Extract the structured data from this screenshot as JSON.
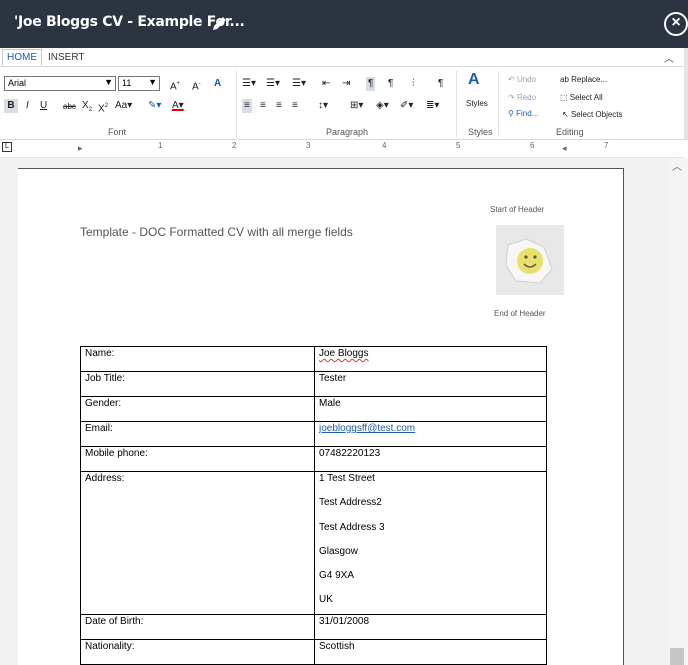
{
  "window": {
    "title": "'Joe Bloggs CV - Example For..."
  },
  "ribbon": {
    "tabs": [
      "HOME",
      "INSERT"
    ],
    "font": {
      "family": "Arial",
      "size": "11",
      "group_label": "Font"
    },
    "paragraph": {
      "group_label": "Paragraph"
    },
    "styles": {
      "label": "Styles",
      "group_label": "Styles"
    },
    "editing": {
      "undo": "Undo",
      "redo": "Redo",
      "find": "Find...",
      "replace": "Replace...",
      "select_all": "Select All",
      "select_objects": "Select Objects",
      "group_label": "Editing"
    }
  },
  "ruler": {
    "marks": [
      "1",
      "2",
      "3",
      "4",
      "5",
      "6",
      "7"
    ]
  },
  "document": {
    "header_start": "Start of Header",
    "header_end": "End of Header",
    "template_text": "Template - DOC Formatted CV with all merge fields",
    "table": {
      "rows": [
        {
          "label": "Name:",
          "value": "Joe Bloggs"
        },
        {
          "label": "Job Title:",
          "value": "Tester"
        },
        {
          "label": "Gender:",
          "value": "Male"
        },
        {
          "label": "Email:",
          "value": "joebloggsff@test.com"
        },
        {
          "label": "Mobile phone:",
          "value": "07482220123"
        },
        {
          "label": "Address:",
          "lines": [
            "1 Test Street",
            "Test Address2",
            "Test Address 3",
            "Glasgow",
            "G4 9XA",
            "UK"
          ]
        },
        {
          "label": "Date of Birth:",
          "value": "31/01/2008"
        },
        {
          "label": "Nationality:",
          "value": "Scottish"
        }
      ]
    }
  },
  "colors": {
    "titlebar": "#2b3440",
    "accent": "#1a5da8"
  }
}
